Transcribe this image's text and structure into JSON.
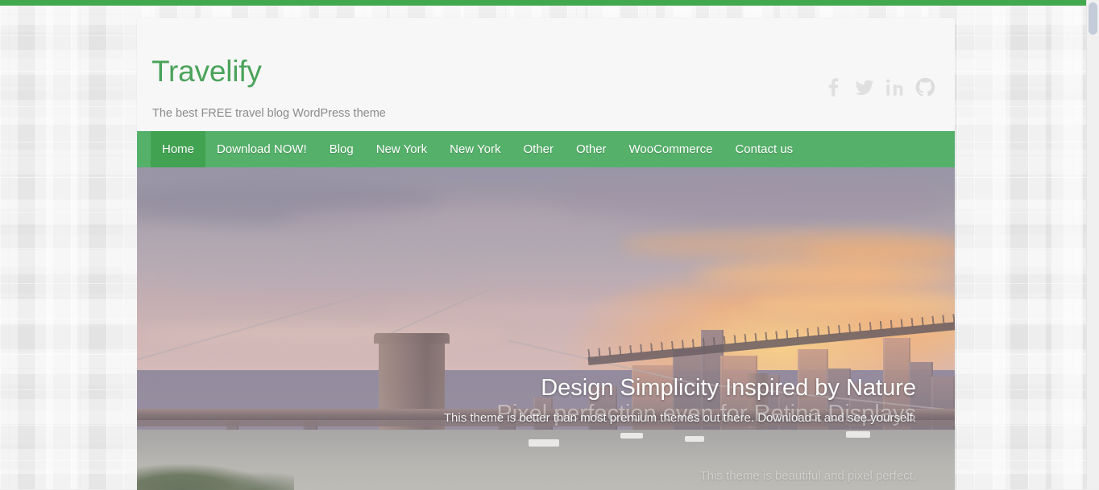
{
  "site": {
    "title": "Travelify",
    "description": "The best FREE travel blog WordPress theme",
    "accent_green": "#4aa35a",
    "nav_green": "#55b06a",
    "nav_active_green": "#41a352",
    "top_bar_green": "#42a84f",
    "header_background": "#f7f7f7",
    "page_background": "#ececec"
  },
  "social": {
    "items": [
      {
        "icon": "facebook-icon",
        "label": "Facebook"
      },
      {
        "icon": "twitter-icon",
        "label": "Twitter"
      },
      {
        "icon": "linkedin-icon",
        "label": "LinkedIn"
      },
      {
        "icon": "github-icon",
        "label": "GitHub"
      }
    ]
  },
  "nav": {
    "items": [
      {
        "label": "Home",
        "active": true
      },
      {
        "label": "Download NOW!",
        "active": false
      },
      {
        "label": "Blog",
        "active": false
      },
      {
        "label": "New York",
        "active": false
      },
      {
        "label": "New York",
        "active": false
      },
      {
        "label": "Other",
        "active": false
      },
      {
        "label": "Other",
        "active": false
      },
      {
        "label": "WooCommerce",
        "active": false
      },
      {
        "label": "Contact us",
        "active": false
      }
    ]
  },
  "slider": {
    "image_alt": "Brooklyn Bridge and lower Manhattan skyline at sunset",
    "incoming_slide": {
      "title": "Design Simplicity Inspired by Nature",
      "text": "This theme is better than most premium themes out there. Download it and see yourself."
    },
    "outgoing_slide": {
      "title": "Pixel perfection even for Retina Displays",
      "text": "This theme is beautiful and pixel perfect."
    }
  },
  "scrollbar": {
    "thumb_color": "#c3ccd8",
    "track_color": "#f0f0f0"
  }
}
